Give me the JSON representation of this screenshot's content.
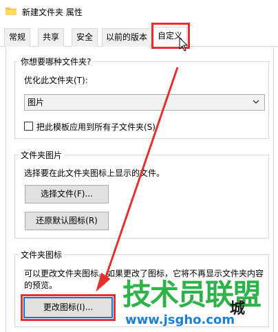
{
  "window": {
    "title": "新建文件夹 属性",
    "icon": "folder-icon"
  },
  "tabs": [
    {
      "label": "常规"
    },
    {
      "label": "共享"
    },
    {
      "label": "安全"
    },
    {
      "label": "以前的版本"
    },
    {
      "label": "自定义",
      "active": true
    }
  ],
  "folder_type": {
    "group_title": "你想要哪种文件夹?",
    "optimize_label": "优化此文件夹(T):",
    "selected_option": "图片",
    "apply_checkbox_label": "把此模板应用到所有子文件夹(S)",
    "apply_checked": false
  },
  "folder_picture": {
    "group_title": "文件夹图片",
    "description": "选择要在此文件夹图标上显示的文件。",
    "choose_file_button": "选择文件(F)...",
    "restore_default_button": "还原默认图标(R)"
  },
  "folder_icon": {
    "group_title": "文件夹图标",
    "description_line1": "可以更改文件夹图标。如果更改了图标，它将不再显示文件夹内容",
    "description_line2": "的预览。",
    "change_icon_button": "更改图标(I)..."
  },
  "watermark": {
    "main": "技术员联盟",
    "city": "城",
    "url": "www.jsgho.com"
  },
  "colors": {
    "annotation": "#e3312f",
    "watermark_green": "#2fb24a",
    "watermark_blue": "#1d7fd0"
  }
}
